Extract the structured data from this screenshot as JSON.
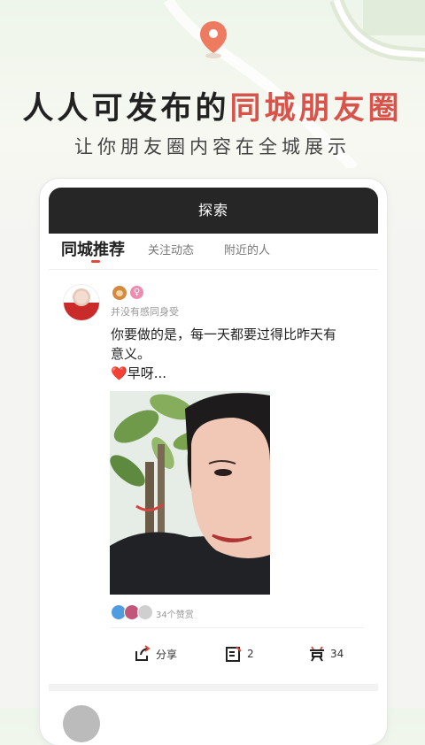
{
  "hero": {
    "title_part1": "人人可发布的",
    "title_accent": "同城朋友圈",
    "subtitle": "让你朋友圈内容在全城展示",
    "accent_color": "#d9534a"
  },
  "app": {
    "header_title": "探索",
    "tabs": [
      {
        "label": "同城推荐",
        "active": true
      },
      {
        "label": "关注动态",
        "active": false
      },
      {
        "label": "附近的人",
        "active": false
      }
    ]
  },
  "post": {
    "username": "并没有感同身受",
    "gender_icon": "female-icon",
    "level_icon": "monkey-badge-icon",
    "text_line1": "你要做的是，每一天都要过得比昨天有",
    "text_line2": "意义。",
    "heart_glyph": "❤️",
    "text_line3": "早呀...",
    "likes_text": "34个赞赏",
    "actions": {
      "share_label": "分享",
      "comment_count": "2",
      "reward_count": "34"
    }
  }
}
